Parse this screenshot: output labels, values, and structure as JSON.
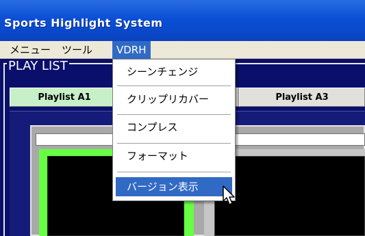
{
  "window": {
    "title": "Sports Highlight System"
  },
  "menubar": {
    "items": [
      {
        "label": "メニュー"
      },
      {
        "label": "ツール"
      },
      {
        "label": "VDRH",
        "active": true
      }
    ]
  },
  "playlist": {
    "label": "PLAY LIST",
    "tabs": [
      {
        "label": "Playlist A1",
        "selected": true
      },
      {
        "label": "Playlist A3",
        "selected": false
      }
    ]
  },
  "dropdown": {
    "items": [
      {
        "label": "シーンチェンジ"
      },
      {
        "label": "クリップリカバー"
      },
      {
        "label": "コンプレス"
      },
      {
        "label": "フォーマット"
      },
      {
        "label": "バージョン表示",
        "highlighted": true
      }
    ]
  },
  "colors": {
    "title_bar": "#0a4fd6",
    "menu_highlight": "#316ac5",
    "app_background": "#0a0f6b",
    "selected_tab": "#c8f0c8",
    "selected_clip_border": "#66ff44"
  },
  "icons": {
    "cursor": "arrow-pointer-icon"
  }
}
